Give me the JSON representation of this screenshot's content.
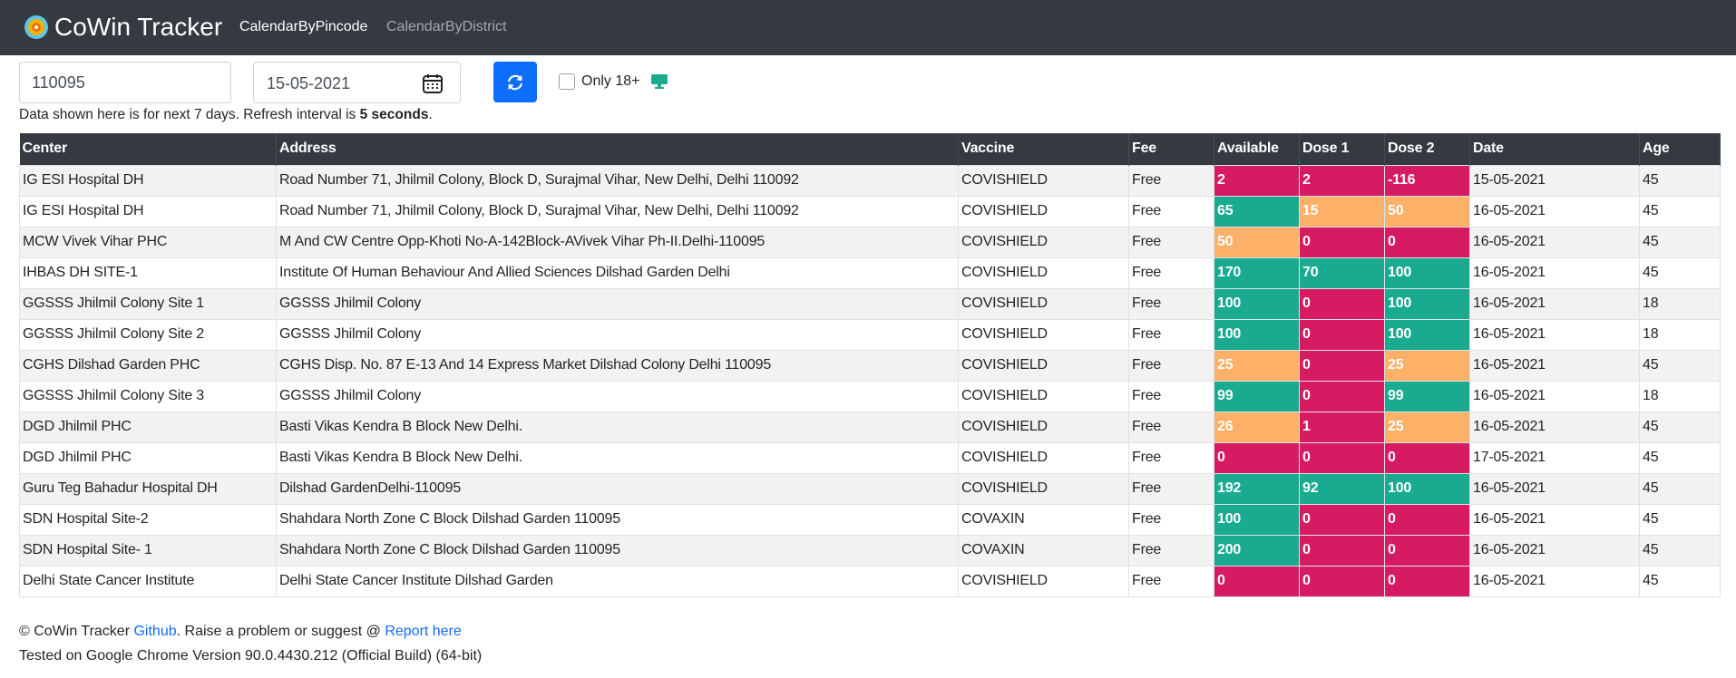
{
  "nav": {
    "brand": "CoWin Tracker",
    "links": [
      "CalendarByPincode",
      "CalendarByDistrict"
    ]
  },
  "controls": {
    "pincode": "110095",
    "date": "15-05-2021",
    "only18_label": "Only 18+"
  },
  "info": {
    "prefix": "Data shown here is for next 7 days. Refresh interval is ",
    "interval": "5 seconds",
    "suffix": "."
  },
  "table": {
    "headers": [
      "Center",
      "Address",
      "Vaccine",
      "Fee",
      "Available",
      "Dose 1",
      "Dose 2",
      "Date",
      "Age"
    ],
    "rows": [
      [
        "IG ESI Hospital DH",
        "Road Number 71, Jhilmil Colony, Block D, Surajmal Vihar, New Delhi, Delhi 110092",
        "COVISHIELD",
        "Free",
        "2",
        "2",
        "-116",
        "15-05-2021",
        "45"
      ],
      [
        "IG ESI Hospital DH",
        "Road Number 71, Jhilmil Colony, Block D, Surajmal Vihar, New Delhi, Delhi 110092",
        "COVISHIELD",
        "Free",
        "65",
        "15",
        "50",
        "16-05-2021",
        "45"
      ],
      [
        "MCW Vivek Vihar PHC",
        "M And CW Centre Opp-Khoti No-A-142Block-AVivek Vihar Ph-II.Delhi-110095",
        "COVISHIELD",
        "Free",
        "50",
        "0",
        "0",
        "16-05-2021",
        "45"
      ],
      [
        "IHBAS DH SITE-1",
        "Institute Of Human Behaviour And Allied Sciences Dilshad Garden Delhi",
        "COVISHIELD",
        "Free",
        "170",
        "70",
        "100",
        "16-05-2021",
        "45"
      ],
      [
        "GGSSS Jhilmil Colony Site 1",
        "GGSSS Jhilmil Colony",
        "COVISHIELD",
        "Free",
        "100",
        "0",
        "100",
        "16-05-2021",
        "18"
      ],
      [
        "GGSSS Jhilmil Colony Site 2",
        "GGSSS Jhilmil Colony",
        "COVISHIELD",
        "Free",
        "100",
        "0",
        "100",
        "16-05-2021",
        "18"
      ],
      [
        "CGHS Dilshad Garden PHC",
        "CGHS Disp. No. 87 E-13 And 14 Express Market Dilshad Colony Delhi 110095",
        "COVISHIELD",
        "Free",
        "25",
        "0",
        "25",
        "16-05-2021",
        "45"
      ],
      [
        "GGSSS Jhilmil Colony Site 3",
        "GGSSS Jhilmil Colony",
        "COVISHIELD",
        "Free",
        "99",
        "0",
        "99",
        "16-05-2021",
        "18"
      ],
      [
        "DGD Jhilmil PHC",
        "Basti Vikas Kendra B Block New Delhi.",
        "COVISHIELD",
        "Free",
        "26",
        "1",
        "25",
        "16-05-2021",
        "45"
      ],
      [
        "DGD Jhilmil PHC",
        "Basti Vikas Kendra B Block New Delhi.",
        "COVISHIELD",
        "Free",
        "0",
        "0",
        "0",
        "17-05-2021",
        "45"
      ],
      [
        "Guru Teg Bahadur Hospital DH",
        "Dilshad GardenDelhi-110095",
        "COVISHIELD",
        "Free",
        "192",
        "92",
        "100",
        "16-05-2021",
        "45"
      ],
      [
        "SDN Hospital Site-2",
        "Shahdara North Zone C Block Dilshad Garden 110095",
        "COVAXIN",
        "Free",
        "100",
        "0",
        "0",
        "16-05-2021",
        "45"
      ],
      [
        "SDN Hospital Site- 1",
        "Shahdara North Zone C Block Dilshad Garden 110095",
        "COVAXIN",
        "Free",
        "200",
        "0",
        "0",
        "16-05-2021",
        "45"
      ],
      [
        "Delhi State Cancer Institute",
        "Delhi State Cancer Institute Dilshad Garden",
        "COVISHIELD",
        "Free",
        "0",
        "0",
        "0",
        "16-05-2021",
        "45"
      ]
    ],
    "cell_colors": [
      [
        "red",
        "red",
        "red"
      ],
      [
        "green",
        "orange",
        "orange"
      ],
      [
        "orange",
        "red",
        "red"
      ],
      [
        "green",
        "green",
        "green"
      ],
      [
        "green",
        "red",
        "green"
      ],
      [
        "green",
        "red",
        "green"
      ],
      [
        "orange",
        "red",
        "orange"
      ],
      [
        "green",
        "red",
        "green"
      ],
      [
        "orange",
        "red",
        "orange"
      ],
      [
        "red",
        "red",
        "red"
      ],
      [
        "green",
        "green",
        "green"
      ],
      [
        "green",
        "red",
        "red"
      ],
      [
        "green",
        "red",
        "red"
      ],
      [
        "red",
        "red",
        "red"
      ]
    ]
  },
  "footer": {
    "copyright": "© CoWin Tracker ",
    "github": "Github",
    "raise": ". Raise a problem or suggest @ ",
    "report": "Report here",
    "tested": "Tested on Google Chrome Version 90.0.4430.212 (Official Build) (64-bit)"
  },
  "colors": {
    "navbar": "#343a40",
    "primary": "#0d6efd",
    "red": "#d61b63",
    "green": "#1aaa90",
    "orange": "#fdb067"
  }
}
